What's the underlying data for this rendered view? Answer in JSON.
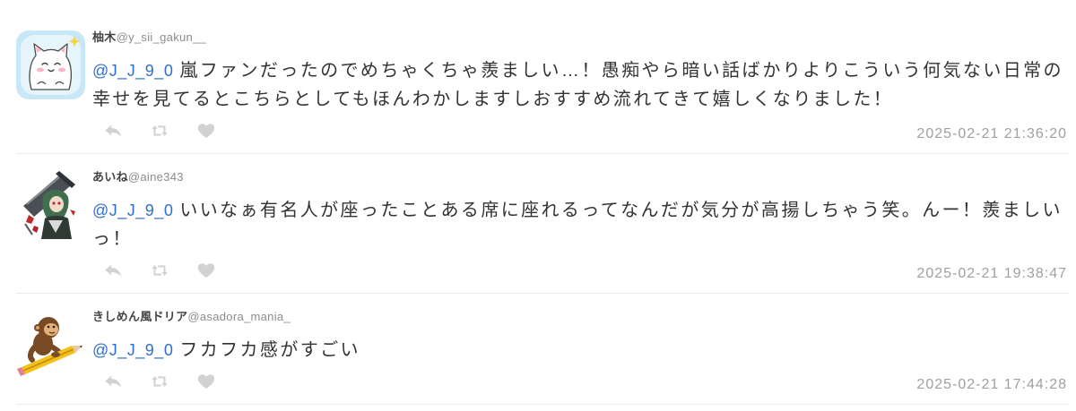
{
  "replies": [
    {
      "name": "柚木",
      "handle": "@y_sii_gakun__",
      "mention": "@J_J_9_0",
      "text": "嵐ファンだったのでめちゃくちゃ羨ましい…！愚痴やら暗い話ばかりよりこういう何気ない日常の幸せを見てるとこちらとしてもほんわかしますしおすすめ流れてきて嬉しくなりました！",
      "timestamp": "2025-02-21 21:36:20"
    },
    {
      "name": "あいね",
      "handle": "@aine343",
      "mention": "@J_J_9_0",
      "text": "いいなぁ有名人が座ったことある席に座れるってなんだが気分が高揚しちゃう笑。んー！羨ましいっ！",
      "timestamp": "2025-02-21 19:38:47"
    },
    {
      "name": "きしめん風ドリア",
      "handle": "@asadora_mania_",
      "mention": "@J_J_9_0",
      "text": "フカフカ感がすごい",
      "timestamp": "2025-02-21 17:44:28"
    }
  ],
  "actions": [
    {
      "icon": "reply-icon"
    },
    {
      "icon": "retweet-icon"
    },
    {
      "icon": "heart-icon"
    }
  ],
  "colors": {
    "text": "#333333",
    "mention": "#2e6fcc",
    "handle": "#8c8c8c",
    "timestamp": "#a0a0a0",
    "action_icon": "#d2d2d2",
    "divider": "#ececec"
  }
}
